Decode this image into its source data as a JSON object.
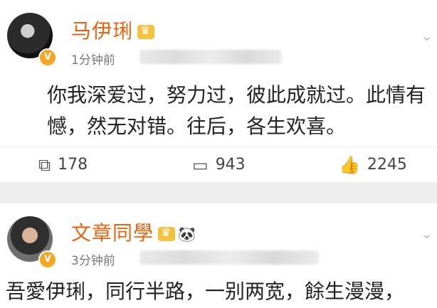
{
  "posts": [
    {
      "username": "马伊琍",
      "time": "1分钟前",
      "content": "你我深爱过，努力过，彼此成就过。此情有憾，然无对错。往后，各生欢喜。",
      "actions": {
        "repost": "178",
        "comment": "943",
        "like": "2245"
      }
    },
    {
      "username": "文章同學",
      "time": "3分钟前",
      "content": "吾愛伊琍，同行半路，一别两宽，餘生漫漫，"
    }
  ],
  "icons": {
    "verified": "V",
    "crown": "crown-icon",
    "panda": "panda-icon",
    "repost": "repost-icon",
    "comment": "comment-icon",
    "like": "thumbs-up-icon"
  },
  "colors": {
    "username": "#e8620f",
    "verified_badge": "#f5a623",
    "divider": "#eeeeee"
  }
}
